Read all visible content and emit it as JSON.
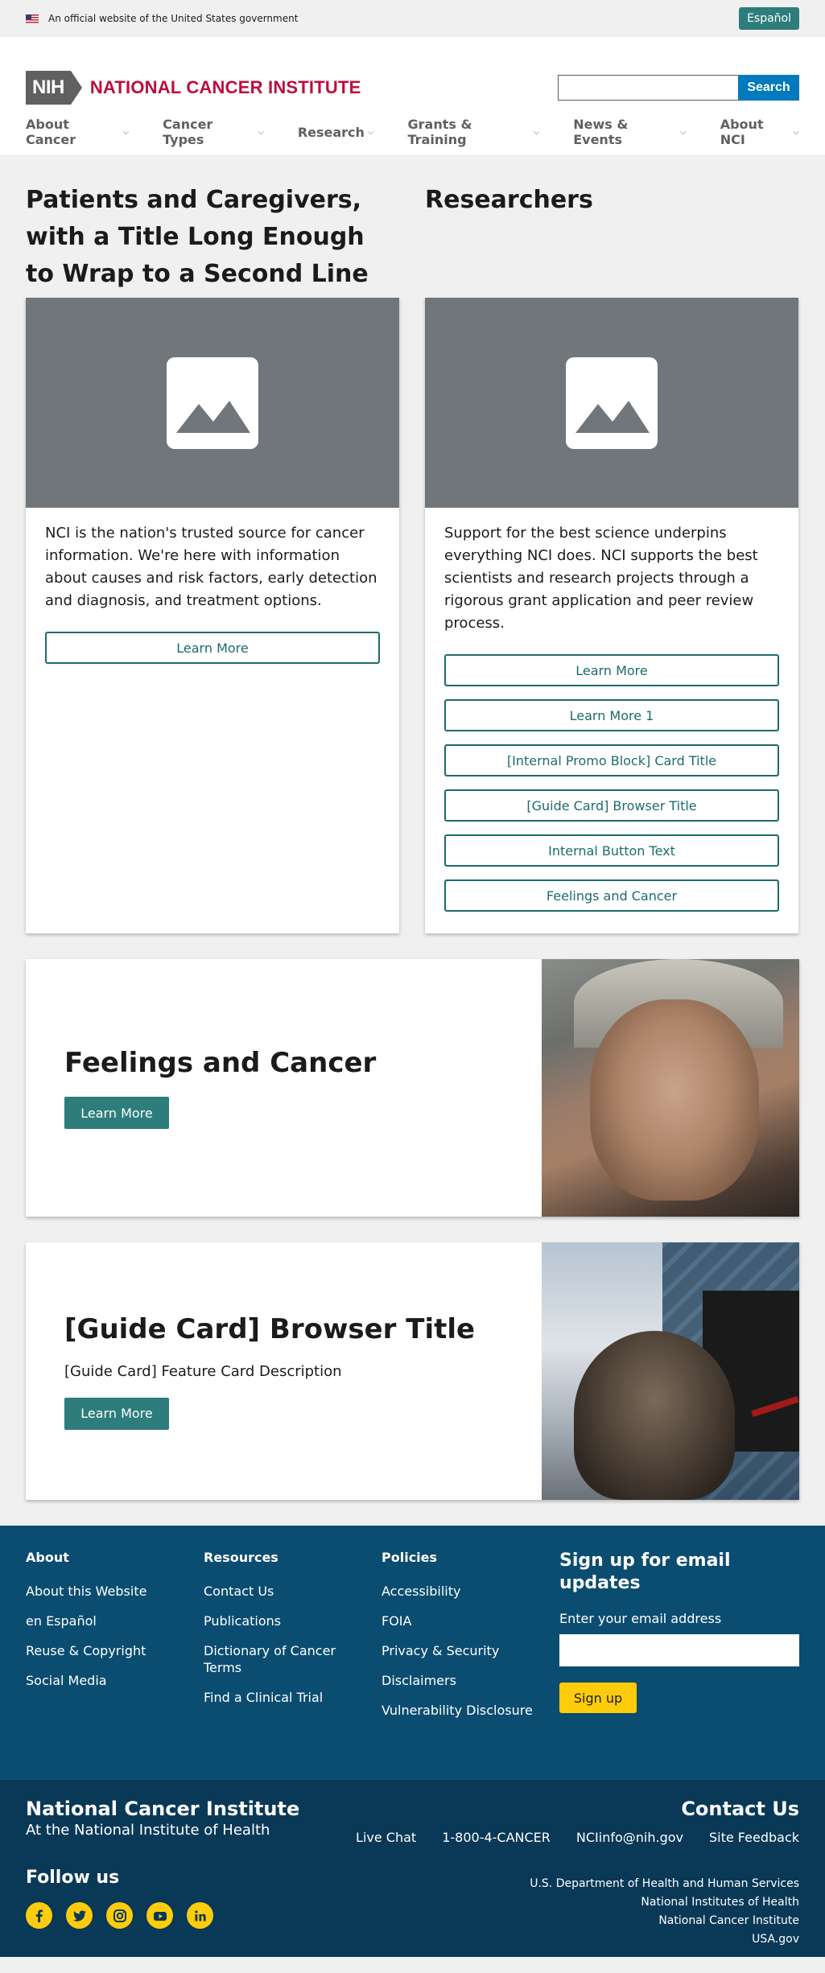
{
  "gov_banner": {
    "text": "An official website of the United States government",
    "espanol_label": "Español"
  },
  "header": {
    "logo_abbr": "NIH",
    "logo_text": "NATIONAL CANCER INSTITUTE",
    "search_placeholder": "",
    "search_label": "Search"
  },
  "nav": {
    "items": [
      {
        "label": "About Cancer"
      },
      {
        "label": "Cancer Types"
      },
      {
        "label": "Research"
      },
      {
        "label": "Grants & Training"
      },
      {
        "label": "News & Events"
      },
      {
        "label": "About NCI"
      }
    ]
  },
  "columns": [
    {
      "title": "Patients and Caregivers, with a Title Long Enough to Wrap to a Second Line",
      "text": "NCI is the nation's trusted source for cancer information. We're here with information about causes and risk factors, early detection and diagnosis, and treatment options.",
      "buttons": [
        "Learn More"
      ]
    },
    {
      "title": "Researchers",
      "text": "Support for the best science underpins everything NCI does. NCI supports the best scientists and research projects through a rigorous grant application and peer review process.",
      "buttons": [
        "Learn More",
        "Learn More 1",
        "[Internal Promo Block] Card Title",
        "[Guide Card] Browser Title",
        "Internal Button Text",
        "Feelings and Cancer"
      ]
    }
  ],
  "features": [
    {
      "title": "Feelings and Cancer",
      "description": "",
      "button": "Learn More"
    },
    {
      "title": "[Guide Card] Browser Title",
      "description": "[Guide Card] Feature Card Description",
      "button": "Learn More"
    }
  ],
  "footer": {
    "about": {
      "heading": "About",
      "links": [
        "About this Website",
        "en Español",
        "Reuse & Copyright",
        "Social Media"
      ]
    },
    "resources": {
      "heading": "Resources",
      "links": [
        "Contact Us",
        "Publications",
        "Dictionary of Cancer Terms",
        "Find a Clinical Trial"
      ]
    },
    "policies": {
      "heading": "Policies",
      "links": [
        "Accessibility",
        "FOIA",
        "Privacy & Security",
        "Disclaimers",
        "Vulnerability Disclosure"
      ]
    },
    "signup": {
      "heading": "Sign up for email updates",
      "label": "Enter your email address",
      "button": "Sign up"
    }
  },
  "lower_footer": {
    "name": "National Cancer Institute",
    "sub": "At the National Institute of Health",
    "follow": "Follow us",
    "socials": [
      "facebook-icon",
      "twitter-icon",
      "instagram-icon",
      "youtube-icon",
      "linkedin-icon"
    ],
    "contact_heading": "Contact Us",
    "contact_links": [
      "Live Chat",
      "1-800-4-CANCER",
      "NCIinfo@nih.gov",
      "Site Feedback"
    ],
    "agencies": [
      "U.S. Department of Health and Human Services",
      "National Institutes of Health",
      "National Cancer Institute",
      "USA.gov"
    ]
  },
  "colors": {
    "teal": "#2e7d7d",
    "nci_red": "#bb0e3d",
    "search_blue": "#007abd",
    "footer_blue": "#0b4d70",
    "footer_dark": "#0a3957",
    "signup_yellow": "#fdcc0a"
  }
}
